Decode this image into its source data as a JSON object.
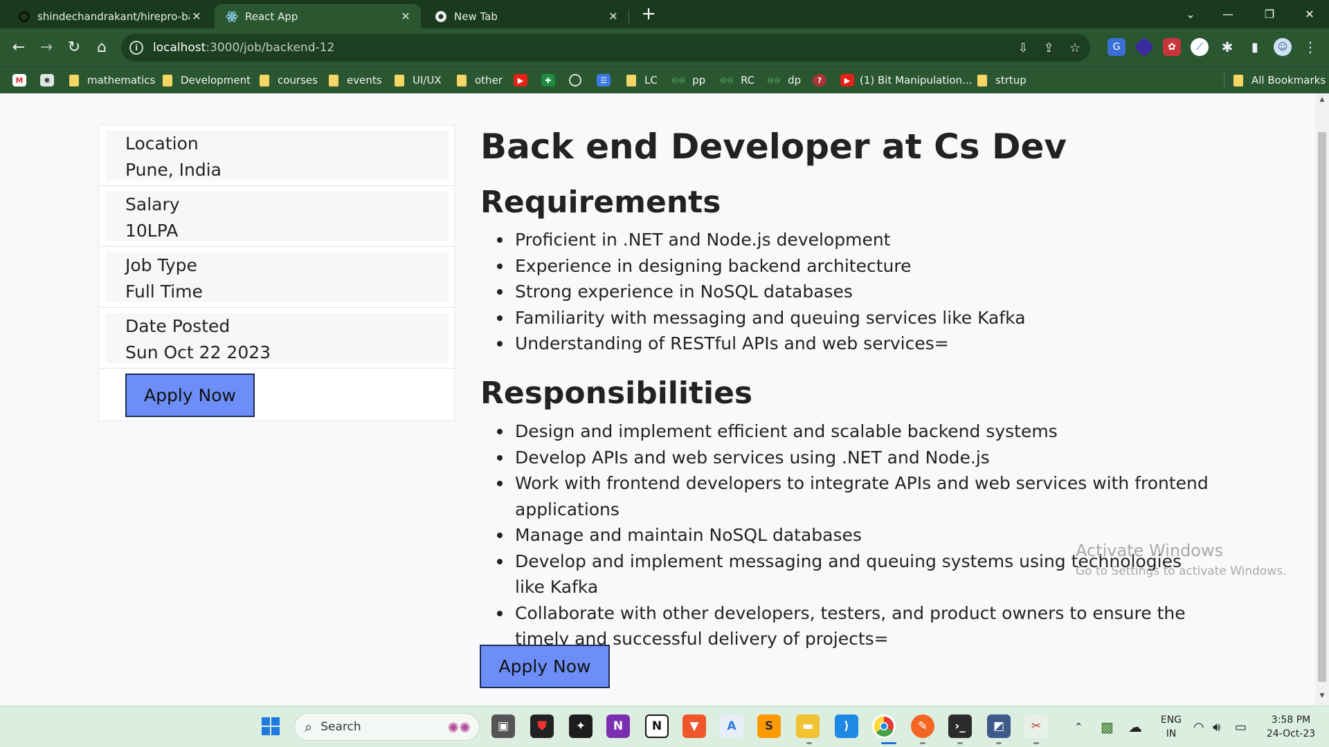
{
  "browser": {
    "tabs": [
      {
        "title": "shindechandrakant/hirepro-back",
        "icon": "github-icon"
      },
      {
        "title": "React App",
        "icon": "react-icon",
        "active": true
      },
      {
        "title": "New Tab",
        "icon": "chrome-icon"
      }
    ],
    "url_host": "localhost",
    "url_path": ":3000/job/backend-12",
    "bookmarks": [
      {
        "label": "mathematics",
        "type": "folder"
      },
      {
        "label": "Development",
        "type": "folder"
      },
      {
        "label": "courses",
        "type": "folder"
      },
      {
        "label": "events",
        "type": "folder"
      },
      {
        "label": "UI/UX",
        "type": "folder"
      },
      {
        "label": "other",
        "type": "folder"
      },
      {
        "label": "LC",
        "type": "folder"
      },
      {
        "label": "pp",
        "type": "link"
      },
      {
        "label": "RC",
        "type": "link"
      },
      {
        "label": "dp",
        "type": "link"
      },
      {
        "label": "(1) Bit Manipulation...",
        "type": "youtube"
      },
      {
        "label": "strtup",
        "type": "folder"
      },
      {
        "label": "All Bookmarks",
        "type": "folder"
      }
    ]
  },
  "job": {
    "title": "Back end Developer at Cs Dev",
    "details": [
      {
        "label": "Location",
        "value": "Pune, India"
      },
      {
        "label": "Salary",
        "value": "10LPA"
      },
      {
        "label": "Job Type",
        "value": "Full Time"
      },
      {
        "label": "Date Posted",
        "value": "Sun Oct 22 2023"
      }
    ],
    "apply_label": "Apply Now",
    "requirements_heading": "Requirements",
    "requirements": [
      "Proficient in .NET and Node.js development",
      "Experience in designing backend architecture",
      "Strong experience in NoSQL databases",
      "Familiarity with messaging and queuing services like Kafka",
      "Understanding of RESTful APIs and web services="
    ],
    "responsibilities_heading": "Responsibilities",
    "responsibilities": [
      "Design and implement efficient and scalable backend systems",
      "Develop APIs and web services using .NET and Node.js",
      "Work with frontend developers to integrate APIs and web services with frontend applications",
      "Manage and maintain NoSQL databases",
      "Develop and implement messaging and queuing systems using technologies like Kafka",
      "Collaborate with other developers, testers, and product owners to ensure the timely and successful delivery of projects="
    ]
  },
  "watermark": {
    "line1": "Activate Windows",
    "line2": "Go to Settings to activate Windows."
  },
  "taskbar": {
    "search_label": "Search",
    "lang_top": "ENG",
    "lang_bottom": "IN",
    "time": "3:58 PM",
    "date": "24-Oct-23"
  },
  "colors": {
    "accent_button": "#6d8ef7",
    "browser_frame": "#2a5630"
  }
}
